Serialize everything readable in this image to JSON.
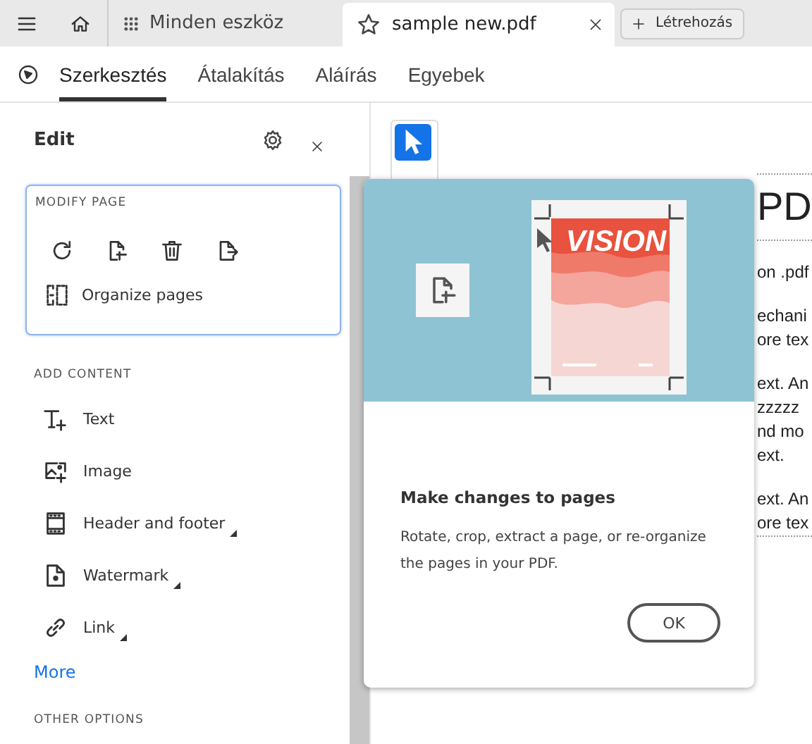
{
  "top_bar": {
    "home_tab": {
      "label": "Minden eszköz"
    },
    "document_tab": {
      "label": "sample new.pdf",
      "selected": true
    },
    "create_button": {
      "label": "Létrehozás"
    }
  },
  "toolbar": {
    "tabs": [
      {
        "label": "Szerkesztés",
        "selected": true
      },
      {
        "label": "Átalakítás",
        "selected": false
      },
      {
        "label": "Aláírás",
        "selected": false
      },
      {
        "label": "Egyebek",
        "selected": false
      }
    ]
  },
  "side_panel": {
    "title": "Edit",
    "modify_page": {
      "heading": "MODIFY PAGE",
      "organize_label": "Organize pages"
    },
    "add_content": {
      "heading": "ADD CONTENT",
      "items": [
        {
          "label": "Text",
          "has_submenu": false
        },
        {
          "label": "Image",
          "has_submenu": false
        },
        {
          "label": "Header and footer",
          "has_submenu": true
        },
        {
          "label": "Watermark",
          "has_submenu": true
        },
        {
          "label": "Link",
          "has_submenu": true
        }
      ],
      "more_link": "More"
    },
    "other_options": {
      "heading": "OTHER OPTIONS"
    }
  },
  "document": {
    "heading": "PD",
    "paragraphs": [
      [
        "on .pdf"
      ],
      [
        "echani",
        "ore tex"
      ],
      [
        "ext. An",
        "zzzzz",
        "nd mo",
        "ext."
      ],
      [
        "ext. An",
        "ore tex"
      ]
    ]
  },
  "popover": {
    "illustration_text": "VISION",
    "title": "Make changes to pages",
    "body": "Rotate, crop, extract a page, or re-organize the pages in your PDF.",
    "button": "OK"
  }
}
